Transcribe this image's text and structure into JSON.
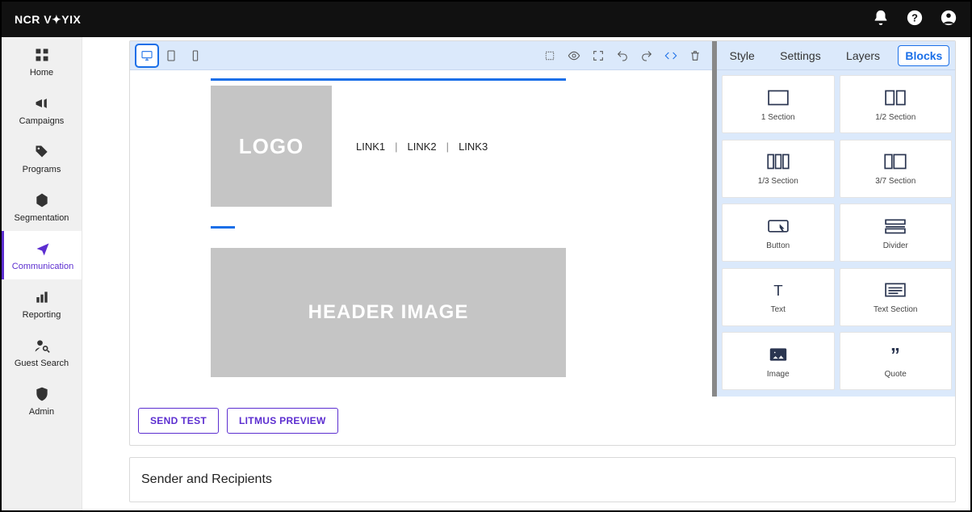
{
  "brand": "NCR V✦YIX",
  "sidebar": {
    "items": [
      {
        "label": "Home"
      },
      {
        "label": "Campaigns"
      },
      {
        "label": "Programs"
      },
      {
        "label": "Segmentation"
      },
      {
        "label": "Communication"
      },
      {
        "label": "Reporting"
      },
      {
        "label": "Guest Search"
      },
      {
        "label": "Admin"
      }
    ]
  },
  "editor": {
    "logo_text": "LOGO",
    "links": [
      "LINK1",
      "LINK2",
      "LINK3"
    ],
    "header_image_text": "HEADER IMAGE",
    "right_tabs": [
      "Style",
      "Settings",
      "Layers",
      "Blocks"
    ],
    "blocks": [
      {
        "label": "1 Section"
      },
      {
        "label": "1/2 Section"
      },
      {
        "label": "1/3 Section"
      },
      {
        "label": "3/7 Section"
      },
      {
        "label": "Button"
      },
      {
        "label": "Divider"
      },
      {
        "label": "Text"
      },
      {
        "label": "Text Section"
      },
      {
        "label": "Image"
      },
      {
        "label": "Quote"
      }
    ]
  },
  "actions": {
    "send_test": "SEND TEST",
    "litmus_preview": "LITMUS PREVIEW"
  },
  "sections": {
    "sender_recipients": "Sender and Recipients"
  }
}
